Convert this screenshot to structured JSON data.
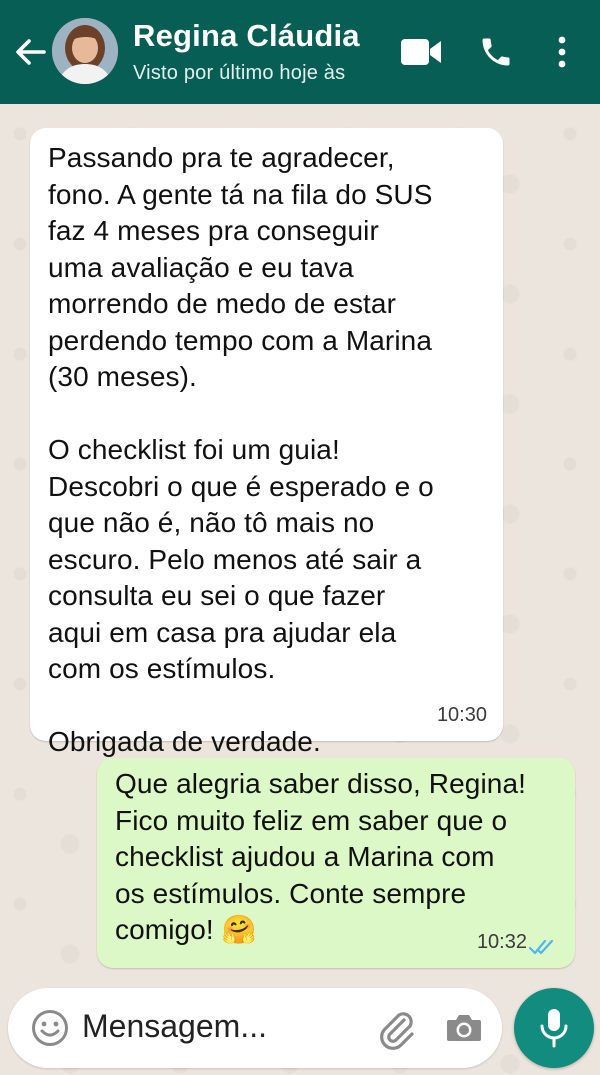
{
  "header": {
    "contact_name": "Regina Cláudia",
    "status": "Visto por último hoje às",
    "accent_color": "#075e54"
  },
  "messages": [
    {
      "direction": "incoming",
      "text": "Passando pra te agradecer,\nfono. A gente tá na fila do SUS\nfaz 4 meses pra conseguir\numa avaliação e eu tava\nmorrendo de medo de estar\nperdendo tempo com a Marina\n(30 meses).\n\nO checklist foi um guia!\nDescobri o que é esperado e o\nque não é, não tô mais no\nescuro. Pelo menos até sair a\nconsulta eu sei o que fazer\naqui em casa pra ajudar ela\ncom os estímulos.\n\nObrigada de verdade.",
      "time": "10:30"
    },
    {
      "direction": "outgoing",
      "text": "Que alegria saber disso, Regina!\nFico muito feliz em saber que o\nchecklist ajudou a Marina com\nos estímulos. Conte sempre\ncomigo! 🤗",
      "time": "10:32",
      "status_icon": "double-check-read-icon"
    }
  ],
  "composer": {
    "placeholder": "Mensagem...",
    "icons": [
      "emoji-icon",
      "attach-clip-icon",
      "camera-icon",
      "microphone-icon"
    ]
  },
  "colors": {
    "outgoing_bubble": "#dcf8c6",
    "incoming_bubble": "#ffffff",
    "read_ticks": "#4fb6ec",
    "mic_button": "#128c7e"
  }
}
